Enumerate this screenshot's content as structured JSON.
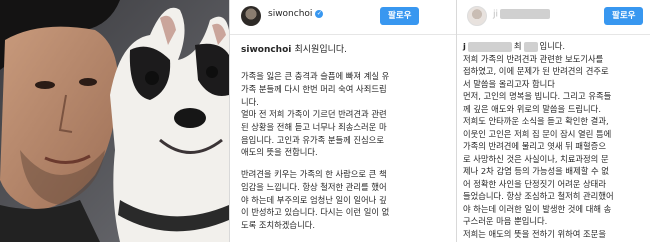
{
  "photo": {
    "alt": ""
  },
  "post1": {
    "username": "siwonchoi",
    "follow_label": "팔로우",
    "caption_user": "siwonchoi",
    "caption_title": "최시원입니다.",
    "para1": [
      "가족을 잃은 큰 충격과 슬픔에 빠져 계실 유",
      "가족 분들께 다시 한번 머리 숙여 사죄드립",
      "니다."
    ],
    "para2": [
      "얼마 전 저희 가족이 기르던 반려견과 관련",
      "된 상황을 전해 듣고 너무나 죄송스러운 마",
      "음입니다. 고인과 유가족 분들께 진심으로",
      "애도의 뜻을 전합니다."
    ],
    "para3": [
      "반려견을 키우는 가족의 한 사람으로 큰 책",
      "임감을 느낍니다. 항상 철저한 관리를 했어",
      "야 하는데 부주의로 엄청난 일이 일어나 깊",
      "이 반성하고 있습니다. 다시는 이런 일이 없",
      "도록 조치하겠습니다."
    ]
  },
  "post2": {
    "username": "ji",
    "follow_label": "팔로우",
    "caption_prefix": "j",
    "caption_title": "최",
    "caption_suffix": "입니다.",
    "lines": [
      "저희 가족의 반려견과 관련한 보도기사를",
      "접하였고, 이에 문제가 된 반려견의 견주로",
      "서 말씀을 올리고자 합니다",
      "먼저, 고인의 명복을 빕니다. 그리고 유족들",
      "께 깊은 애도와 위로의 말씀을 드립니다.",
      "저희도 안타까운 소식을 듣고 확인한 결과,",
      "이웃인 고인은 저희 집 문이 잠시 열린 틈에",
      "가족의 반려견에 물리고 엿새 뒤 패혈증으",
      "로 사망하신 것은 사실이나, 치료과정의 문",
      "제나 2차 감염 등의 가능성을 배제할 수 없",
      "어 정확한 사인을 단정짓기 어려운 상태라",
      "들었습니다. 항상 조심하고 철저히 관리했어",
      "야 하는데 이러한 일이 발생한 것에 대해 송",
      "구스러운 마음 뿐입니다.",
      "저희는 애도의 뜻을 전하기 위하여 조문을"
    ]
  }
}
